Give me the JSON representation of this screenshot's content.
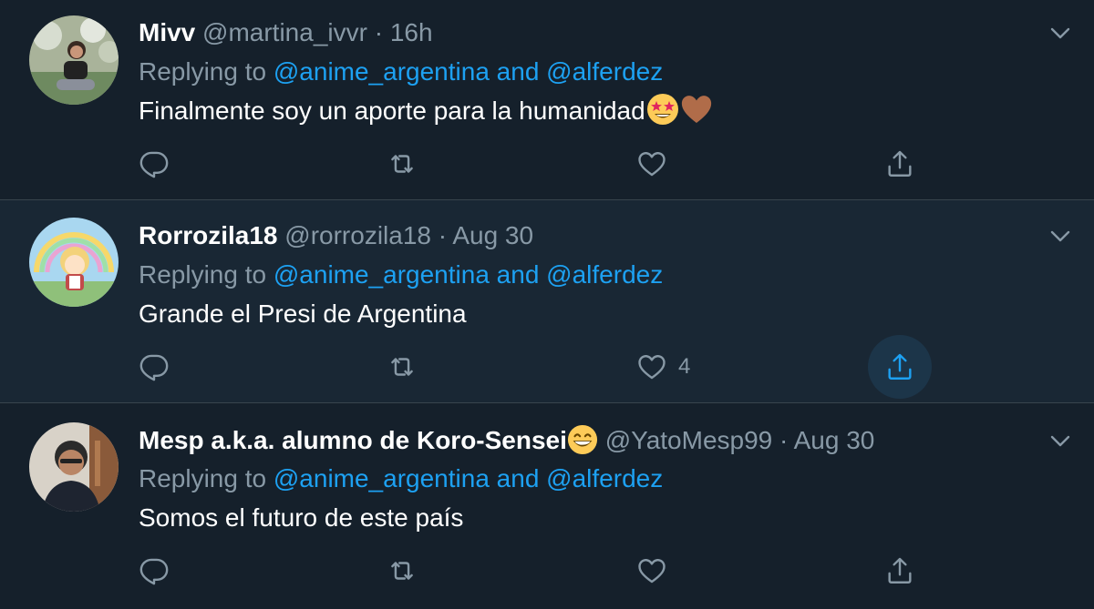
{
  "tweets": [
    {
      "name": "Mivv",
      "handle": "@martina_ivvr",
      "separator": "·",
      "time": "16h",
      "replying_prefix": "Replying to",
      "mention_1": "@anime_argentina",
      "and_word": "and",
      "mention_2": "@alferdez",
      "text": "Finalmente soy un aporte para la humanidad",
      "emojis": [
        "star-struck-emoji",
        "brown-heart-emoji"
      ],
      "like_count": ""
    },
    {
      "name": "Rorrozila18",
      "handle": "@rorrozila18",
      "separator": "·",
      "time": "Aug 30",
      "replying_prefix": "Replying to",
      "mention_1": "@anime_argentina",
      "and_word": "and",
      "mention_2": "@alferdez",
      "text": "Grande el Presi de Argentina",
      "emojis": [],
      "like_count": "4"
    },
    {
      "name": "Mesp a.k.a. alumno de Koro-Sensei",
      "name_emoji": "grinning-face-emoji",
      "handle": "@YatoMesp99",
      "separator": "·",
      "time": "Aug 30",
      "replying_prefix": "Replying to",
      "mention_1": "@anime_argentina",
      "and_word": "and",
      "mention_2": "@alferdez",
      "text": "Somos el futuro de este país",
      "emojis": [],
      "like_count": ""
    }
  ],
  "icons": {
    "reply": "reply-icon",
    "retweet": "retweet-icon",
    "like": "heart-icon",
    "share": "share-icon",
    "menu": "chevron-down-icon"
  },
  "colors": {
    "background": "#15202b",
    "hover_background": "#192734",
    "divider": "#38444d",
    "secondary_text": "#8899a6",
    "link": "#1da1f2"
  }
}
